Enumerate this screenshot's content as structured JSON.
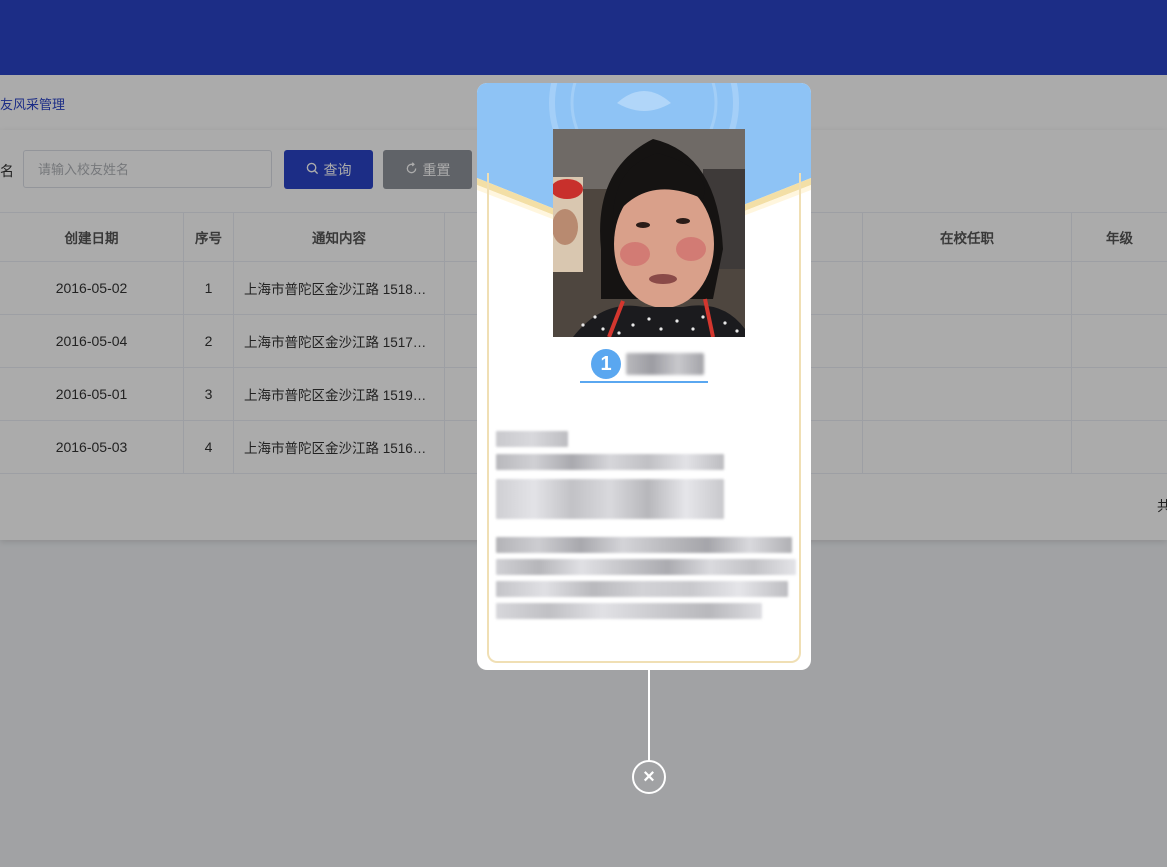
{
  "breadcrumb": "友风采管理",
  "search": {
    "label": "名",
    "placeholder": "请输入校友姓名",
    "value": "",
    "query_label": "查询",
    "reset_label": "重置"
  },
  "table": {
    "columns": [
      "创建日期",
      "序号",
      "通知内容",
      "",
      "在校任职",
      "年级"
    ],
    "rows": [
      [
        "2016-05-02",
        "1",
        "上海市普陀区金沙江路 1518…",
        "",
        "",
        ""
      ],
      [
        "2016-05-04",
        "2",
        "上海市普陀区金沙江路 1517…",
        "",
        "",
        ""
      ],
      [
        "2016-05-01",
        "3",
        "上海市普陀区金沙江路 1519…",
        "",
        "",
        ""
      ],
      [
        "2016-05-03",
        "4",
        "上海市普陀区金沙江路 1516…",
        "",
        "",
        ""
      ]
    ]
  },
  "pagination": {
    "total_label": "共"
  },
  "modal": {
    "badge_number": "1",
    "close_icon": "×"
  },
  "colors": {
    "header": "#2b43c8",
    "primary_button": "#2b43c8",
    "reset_button": "#8f949c",
    "badge": "#5aa7f0",
    "frame_gold": "#f0dfb4"
  },
  "icons": [
    "search-icon",
    "refresh-icon",
    "close-icon"
  ]
}
